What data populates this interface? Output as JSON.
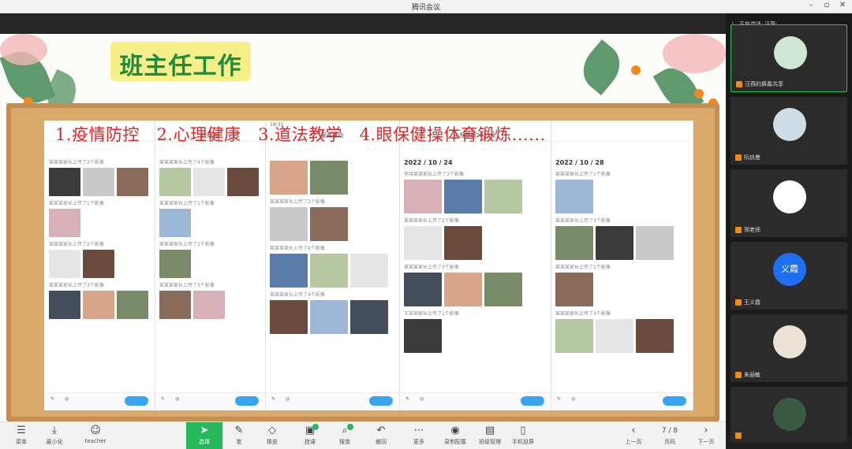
{
  "window": {
    "title": "腾讯会议"
  },
  "slide": {
    "heading": "班主任工作",
    "overlay": "1.疫情防控　2.心理健康　3.道法教学　4.眼保健操体育锻炼......",
    "phones": [
      {
        "status": "",
        "title": "",
        "groups": [
          {
            "label": "某某某家长上传了2个影像",
            "n": 3
          },
          {
            "label": "某某某家长上传了1个影像",
            "n": 1
          },
          {
            "label": "某某某家长上传了2个影像",
            "n": 2
          },
          {
            "label": "某某某家长上传了3个影像",
            "n": 3
          }
        ]
      },
      {
        "status": "",
        "title": "班级圈",
        "groups": [
          {
            "label": "某某某家长上传了4个影像",
            "n": 3
          },
          {
            "label": "某某某家长上传了1个影像",
            "n": 1
          },
          {
            "label": "某某某家长上传了1个影像",
            "n": 1
          },
          {
            "label": "某某某家长上传了3个影像",
            "n": 2
          }
        ]
      },
      {
        "status": "19:31",
        "title": "家务劳动",
        "groups": [
          {
            "label": "",
            "n": 2
          },
          {
            "label": "某某某家长上传了2个影像",
            "n": 2
          },
          {
            "label": "某某某家长上传了6个影像",
            "n": 3
          },
          {
            "label": "某某某家长上传了4个影像",
            "n": 3
          }
        ]
      },
      {
        "status": "",
        "title": "心理健康2022秋",
        "date": "2022 / 10 / 24",
        "groups": [
          {
            "label": "李晓某某家长上传了3个影像",
            "n": 3
          },
          {
            "label": "某某某家长上传了2个影像",
            "n": 2
          },
          {
            "label": "某某某家长上传了3个影像",
            "n": 3
          },
          {
            "label": "王某某家长上传了1个影像",
            "n": 1
          }
        ]
      },
      {
        "status": "",
        "title": "",
        "date": "2022 / 10 / 28",
        "groups": [
          {
            "label": "某某某家长上传了1个影像",
            "n": 1
          },
          {
            "label": "某某某家长上传了3个影像",
            "n": 3
          },
          {
            "label": "某某某家长上传了1个影像",
            "n": 1
          },
          {
            "label": "某某某家长上传了4个影像",
            "n": 3
          }
        ]
      }
    ]
  },
  "toolbar": {
    "items": [
      {
        "label": "菜单",
        "icon": "menu-icon",
        "glyph": "☰"
      },
      {
        "label": "最小化",
        "icon": "minimize-icon",
        "glyph": "⤓"
      },
      {
        "label": "teacher",
        "icon": "teacher-avatar-icon",
        "glyph": "☺"
      },
      {
        "label": "选择",
        "icon": "cursor-icon",
        "glyph": "➤"
      },
      {
        "label": "笔",
        "icon": "pen-icon",
        "glyph": "✎"
      },
      {
        "label": "橡皮",
        "icon": "eraser-icon",
        "glyph": "◇"
      },
      {
        "label": "授课",
        "icon": "teach-icon",
        "glyph": "▣"
      },
      {
        "label": "搜查",
        "icon": "search-icon",
        "glyph": "⌕"
      },
      {
        "label": "撤回",
        "icon": "undo-icon",
        "glyph": "↶"
      },
      {
        "label": "更多",
        "icon": "more-icon",
        "glyph": "⋯"
      },
      {
        "label": "录制配置",
        "icon": "record-icon",
        "glyph": "◉"
      },
      {
        "label": "班级管理",
        "icon": "class-icon",
        "glyph": "▤"
      },
      {
        "label": "手机投屏",
        "icon": "phone-cast-icon",
        "glyph": "▯"
      },
      {
        "label": "上一页",
        "icon": "prev-icon",
        "glyph": "‹"
      },
      {
        "label": "页码",
        "icon": "page-icon",
        "glyph": "7 / 8"
      },
      {
        "label": "下一页",
        "icon": "next-icon",
        "glyph": "›"
      }
    ],
    "page": "7 / 8"
  },
  "panel": {
    "speaking": "正在讲话: 汪燕;",
    "participants": [
      {
        "name": "汪燕的屏幕共享",
        "color": "#cfe8d5"
      },
      {
        "name": "阮玖曼",
        "color": "#cfdde8"
      },
      {
        "name": "郑老师",
        "color": "#ffffff"
      },
      {
        "name": "王义霞",
        "color": "#1e6ff0",
        "initial": "义霞"
      },
      {
        "name": "朱丽敏",
        "color": "#e9e2d5"
      },
      {
        "name": "",
        "color": "#3a5a46"
      }
    ]
  },
  "colors": {
    "accent": "#25b95c",
    "overlay_text": "#e32424",
    "heading": "#1f8a3a"
  }
}
